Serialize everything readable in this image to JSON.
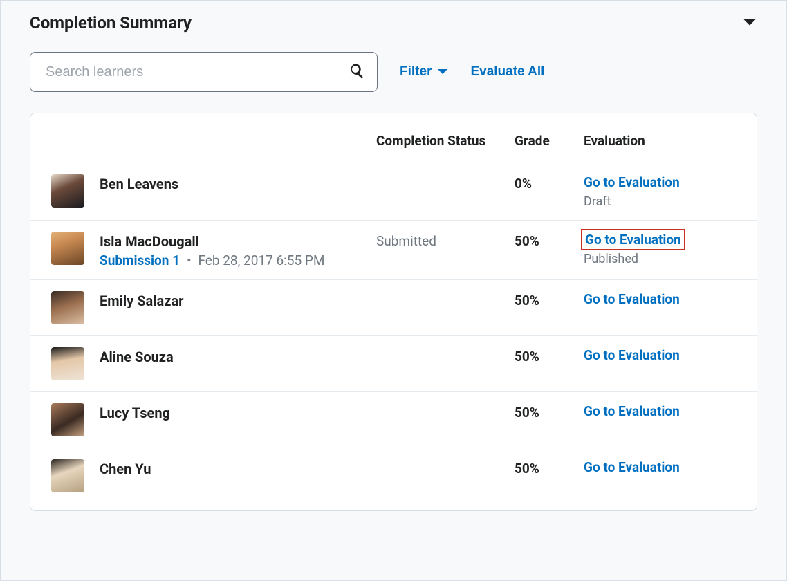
{
  "header": {
    "title": "Completion Summary"
  },
  "search": {
    "placeholder": "Search learners"
  },
  "actions": {
    "filter_label": "Filter",
    "evaluate_all_label": "Evaluate All"
  },
  "table": {
    "columns": {
      "status": "Completion Status",
      "grade": "Grade",
      "evaluation": "Evaluation"
    },
    "eval_link_label": "Go to Evaluation"
  },
  "learners": [
    {
      "name": "Ben Leavens",
      "status": "",
      "grade": "0%",
      "eval_status": "Draft",
      "submission_link": "",
      "submission_date": "",
      "highlighted": false
    },
    {
      "name": "Isla MacDougall",
      "status": "Submitted",
      "grade": "50%",
      "eval_status": "Published",
      "submission_link": "Submission 1",
      "submission_date": "Feb 28, 2017 6:55 PM",
      "highlighted": true
    },
    {
      "name": "Emily Salazar",
      "status": "",
      "grade": "50%",
      "eval_status": "",
      "submission_link": "",
      "submission_date": "",
      "highlighted": false
    },
    {
      "name": "Aline Souza",
      "status": "",
      "grade": "50%",
      "eval_status": "",
      "submission_link": "",
      "submission_date": "",
      "highlighted": false
    },
    {
      "name": "Lucy Tseng",
      "status": "",
      "grade": "50%",
      "eval_status": "",
      "submission_link": "",
      "submission_date": "",
      "highlighted": false
    },
    {
      "name": "Chen Yu",
      "status": "",
      "grade": "50%",
      "eval_status": "",
      "submission_link": "",
      "submission_date": "",
      "highlighted": false
    }
  ]
}
